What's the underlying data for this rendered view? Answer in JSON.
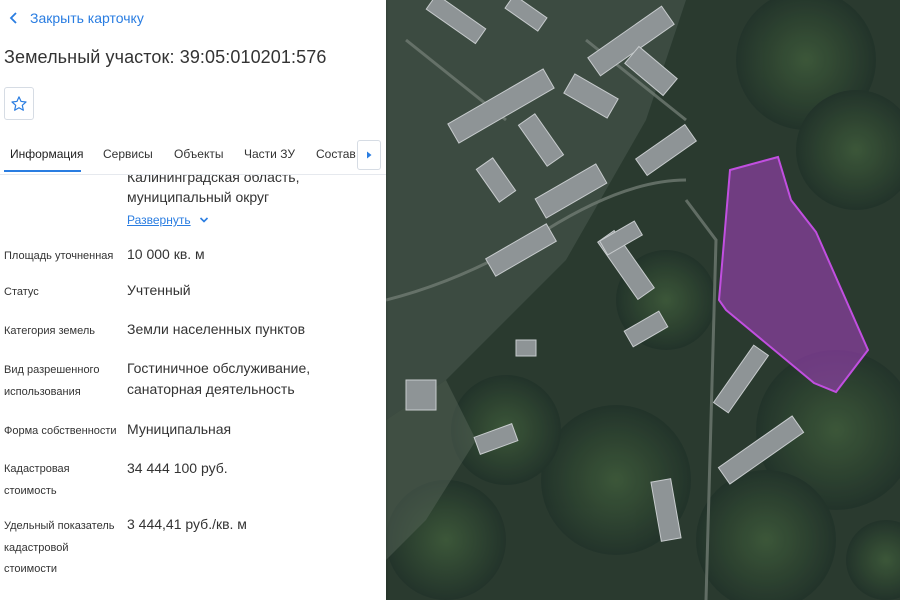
{
  "close_card": {
    "label": "Закрыть карточку",
    "icon": "chevron-left-icon"
  },
  "title": "Земельный участок: 39:05:010201:576",
  "favorite_icon": "star-icon",
  "tabs": [
    {
      "label": "Информация",
      "active": true
    },
    {
      "label": "Сервисы",
      "active": false
    },
    {
      "label": "Объекты",
      "active": false
    },
    {
      "label": "Части ЗУ",
      "active": false
    },
    {
      "label": "Состав",
      "active": false
    }
  ],
  "tabs_next_icon": "caret-right-icon",
  "address": {
    "line1": "Калининградская область,",
    "line2": "муниципальный округ",
    "expand_label": "Развернуть"
  },
  "details": [
    {
      "label": [
        "Площадь уточненная"
      ],
      "value": [
        "10 000 кв. м"
      ]
    },
    {
      "label": [
        "Статус"
      ],
      "value": [
        "Учтенный"
      ]
    },
    {
      "label": [
        "Категория земель"
      ],
      "value": [
        "Земли населенных пунктов"
      ]
    },
    {
      "label": [
        "Вид разрешенного",
        "использования"
      ],
      "value": [
        "Гостиничное обслуживание,",
        "санаторная деятельность"
      ]
    },
    {
      "label": [
        "Форма собственности"
      ],
      "value": [
        "Муниципальная"
      ]
    },
    {
      "label": [
        "Кадастровая",
        "стоимость"
      ],
      "value": [
        "34 444 100 руб."
      ]
    },
    {
      "label": [
        "Удельный показатель",
        "кадастровой",
        "стоимости"
      ],
      "value": [
        "3 444,41 руб./кв. м"
      ]
    }
  ],
  "colors": {
    "accent": "#2a7de1",
    "parcel_fill": "#9b3fb5",
    "parcel_stroke": "#c14fe0"
  }
}
